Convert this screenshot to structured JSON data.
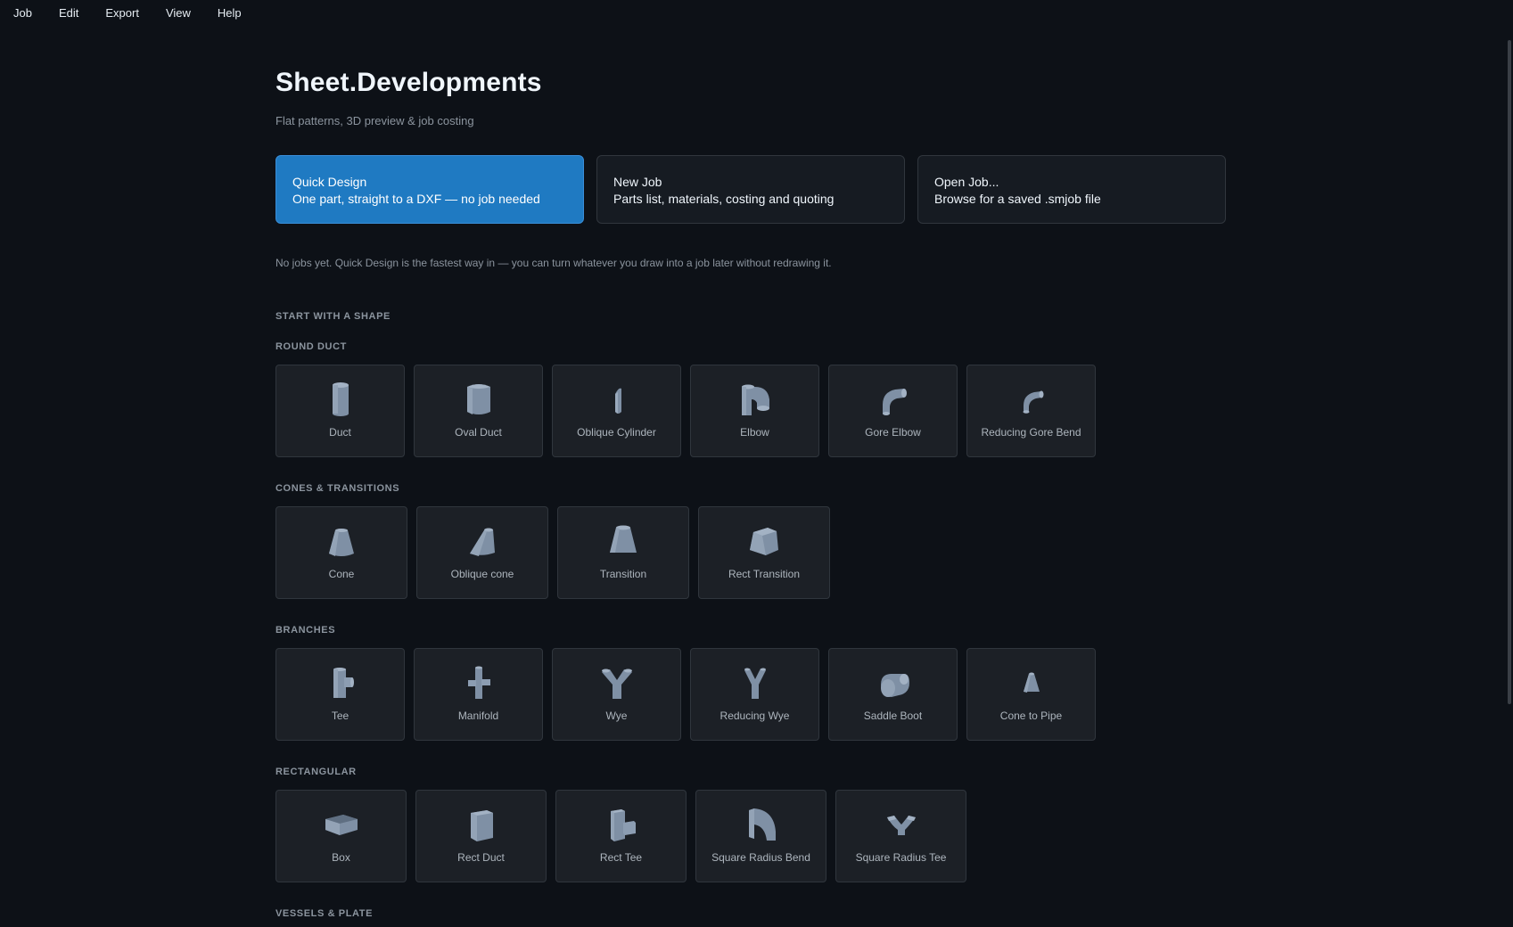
{
  "menu": [
    "Job",
    "Edit",
    "Export",
    "View",
    "Help"
  ],
  "header": {
    "title": "Sheet.Developments",
    "subtitle": "Flat patterns, 3D preview & job costing"
  },
  "actions": [
    {
      "title": "Quick Design",
      "desc": "One part, straight to a DXF — no job needed"
    },
    {
      "title": "New Job",
      "desc": "Parts list, materials, costing and quoting"
    },
    {
      "title": "Open Job...",
      "desc": "Browse for a saved .smjob file"
    }
  ],
  "note": "No jobs yet. Quick Design is the fastest way in — you can turn whatever you draw into a job later without redrawing it.",
  "shapes_heading": "START WITH A SHAPE",
  "groups": [
    {
      "label": "ROUND DUCT",
      "items": [
        {
          "label": "Duct",
          "icon": "duct-icon"
        },
        {
          "label": "Oval Duct",
          "icon": "oval-duct-icon"
        },
        {
          "label": "Oblique Cylinder",
          "icon": "oblique-cylinder-icon"
        },
        {
          "label": "Elbow",
          "icon": "elbow-icon"
        },
        {
          "label": "Gore Elbow",
          "icon": "gore-elbow-icon"
        },
        {
          "label": "Reducing Gore Bend",
          "icon": "reducing-gore-bend-icon"
        }
      ]
    },
    {
      "label": "CONES & TRANSITIONS",
      "items": [
        {
          "label": "Cone",
          "icon": "cone-icon"
        },
        {
          "label": "Oblique cone",
          "icon": "oblique-cone-icon"
        },
        {
          "label": "Transition",
          "icon": "transition-icon"
        },
        {
          "label": "Rect Transition",
          "icon": "rect-transition-icon"
        }
      ]
    },
    {
      "label": "BRANCHES",
      "items": [
        {
          "label": "Tee",
          "icon": "tee-icon"
        },
        {
          "label": "Manifold",
          "icon": "manifold-icon"
        },
        {
          "label": "Wye",
          "icon": "wye-icon"
        },
        {
          "label": "Reducing Wye",
          "icon": "reducing-wye-icon"
        },
        {
          "label": "Saddle Boot",
          "icon": "saddle-boot-icon"
        },
        {
          "label": "Cone to Pipe",
          "icon": "cone-to-pipe-icon"
        }
      ]
    },
    {
      "label": "RECTANGULAR",
      "items": [
        {
          "label": "Box",
          "icon": "box-icon"
        },
        {
          "label": "Rect Duct",
          "icon": "rect-duct-icon"
        },
        {
          "label": "Rect Tee",
          "icon": "rect-tee-icon"
        },
        {
          "label": "Square Radius Bend",
          "icon": "square-radius-bend-icon"
        },
        {
          "label": "Square Radius Tee",
          "icon": "square-radius-tee-icon"
        }
      ]
    },
    {
      "label": "VESSELS & PLATE",
      "items": []
    }
  ],
  "colors": {
    "background": "#0d1117",
    "accent": "#1f7ac2",
    "card": "#161b22",
    "tile": "#1c2026",
    "icon": "#8a9bb0"
  }
}
